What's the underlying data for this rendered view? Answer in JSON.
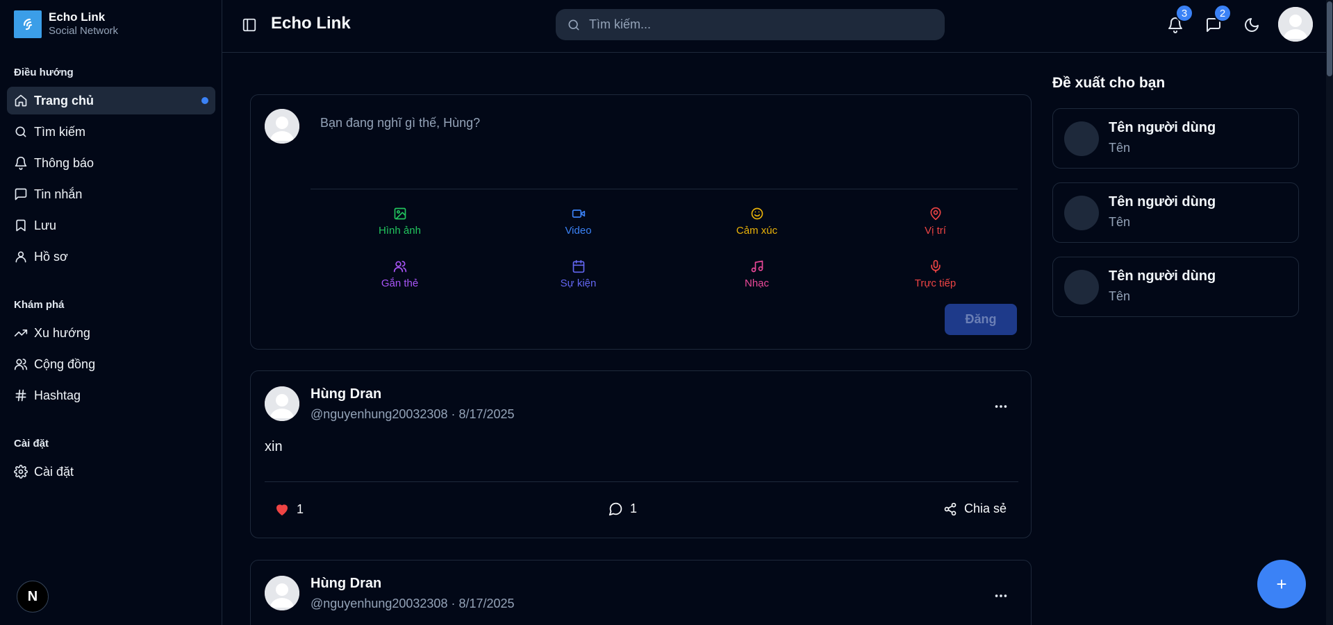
{
  "brand": {
    "title": "Echo Link",
    "subtitle": "Social Network",
    "logo_icon": "echo-link-logo-icon"
  },
  "sidebar": {
    "sections": [
      {
        "title": "Điều hướng",
        "items": [
          {
            "label": "Trang chủ",
            "icon": "home-icon",
            "active": true
          },
          {
            "label": "Tìm kiếm",
            "icon": "search-icon"
          },
          {
            "label": "Thông báo",
            "icon": "bell-icon"
          },
          {
            "label": "Tin nhắn",
            "icon": "message-icon"
          },
          {
            "label": "Lưu",
            "icon": "bookmark-icon"
          },
          {
            "label": "Hồ sơ",
            "icon": "user-icon"
          }
        ]
      },
      {
        "title": "Khám phá",
        "items": [
          {
            "label": "Xu hướng",
            "icon": "trending-icon"
          },
          {
            "label": "Cộng đồng",
            "icon": "users-icon"
          },
          {
            "label": "Hashtag",
            "icon": "hash-icon"
          }
        ]
      },
      {
        "title": "Cài đặt",
        "items": [
          {
            "label": "Cài đặt",
            "icon": "settings-icon"
          }
        ]
      }
    ],
    "footer_badge": "N"
  },
  "topbar": {
    "title": "Echo Link",
    "search_placeholder": "Tìm kiếm...",
    "notifications_count": "3",
    "messages_count": "2"
  },
  "composer": {
    "placeholder": "Bạn đang nghĩ gì thế, Hùng?",
    "actions": [
      {
        "label": "Hình ảnh",
        "icon": "image-icon",
        "color": "#22c55e"
      },
      {
        "label": "Video",
        "icon": "video-icon",
        "color": "#3b82f6"
      },
      {
        "label": "Cảm xúc",
        "icon": "smile-icon",
        "color": "#eab308"
      },
      {
        "label": "Vị trí",
        "icon": "map-pin-icon",
        "color": "#ef4444"
      },
      {
        "label": "Gắn thẻ",
        "icon": "users-icon",
        "color": "#a855f7"
      },
      {
        "label": "Sự kiện",
        "icon": "calendar-icon",
        "color": "#6366f1"
      },
      {
        "label": "Nhạc",
        "icon": "music-icon",
        "color": "#ec4899"
      },
      {
        "label": "Trực tiếp",
        "icon": "mic-icon",
        "color": "#ef4444"
      }
    ],
    "submit_label": "Đăng"
  },
  "posts": [
    {
      "author": "Hùng Dran",
      "meta": "@nguyenhung20032308 · 8/17/2025",
      "content": "xin",
      "likes": "1",
      "comments": "1",
      "share_label": "Chia sẻ"
    },
    {
      "author": "Hùng Dran",
      "meta": "@nguyenhung20032308 · 8/17/2025"
    }
  ],
  "suggestions": {
    "title": "Đề xuất cho bạn",
    "items": [
      {
        "name": "Tên người dùng",
        "handle": "Tên"
      },
      {
        "name": "Tên người dùng",
        "handle": "Tên"
      },
      {
        "name": "Tên người dùng",
        "handle": "Tên"
      }
    ]
  },
  "fab_label": "+",
  "colors": {
    "background": "#020817",
    "accent": "#3b82f6",
    "border": "#1e293b",
    "like": "#ef4444"
  }
}
